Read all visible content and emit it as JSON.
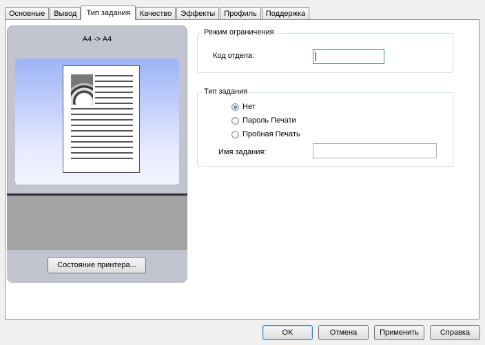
{
  "tabs": [
    {
      "label": "Основные"
    },
    {
      "label": "Вывод"
    },
    {
      "label": "Тип задания"
    },
    {
      "label": "Качество"
    },
    {
      "label": "Эффекты"
    },
    {
      "label": "Профиль"
    },
    {
      "label": "Поддержка"
    }
  ],
  "active_tab": "Тип задания",
  "preview": {
    "caption": "A4 -> A4",
    "printer_status_button": "Состояние принтера..."
  },
  "restriction_group": {
    "title": "Режим ограничения",
    "department_code_label": "Код отдела:",
    "department_code_value": ""
  },
  "job_type_group": {
    "title": "Тип задания",
    "options": [
      "Нет",
      "Пароль Печати",
      "Пробная Печать"
    ],
    "selected": "Нет",
    "job_name_label": "Имя задания:",
    "job_name_value": ""
  },
  "dialog_buttons": {
    "ok": "OK",
    "cancel": "Отмена",
    "apply": "Применить",
    "help": "Справка"
  }
}
